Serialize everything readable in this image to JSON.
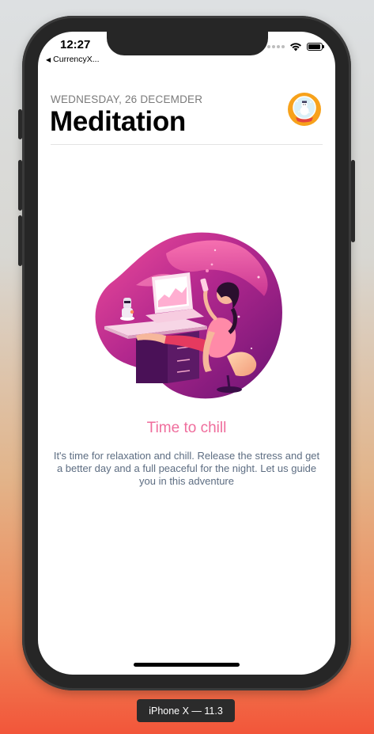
{
  "status_bar": {
    "time": "12:27",
    "back_app": "CurrencyX...",
    "back_icon": "back-triangle-icon"
  },
  "header": {
    "date": "WEDNESDAY, 26 DECEMDER",
    "title": "Meditation",
    "avatar_icon": "snow-globe-avatar-icon"
  },
  "content": {
    "illustration": "woman-relaxing-at-desk-illustration",
    "headline": "Time to chill",
    "body": "It's time for relaxation and chill. Release the stress and get a better day and a full peaceful for the night. Let us guide you in this adventure"
  },
  "simulator": {
    "device_label": "iPhone X — 11.3"
  },
  "colors": {
    "accent_pink": "#ef6d9c",
    "body_text": "#5d6d82",
    "illustration_purple": "#7a1f77"
  }
}
